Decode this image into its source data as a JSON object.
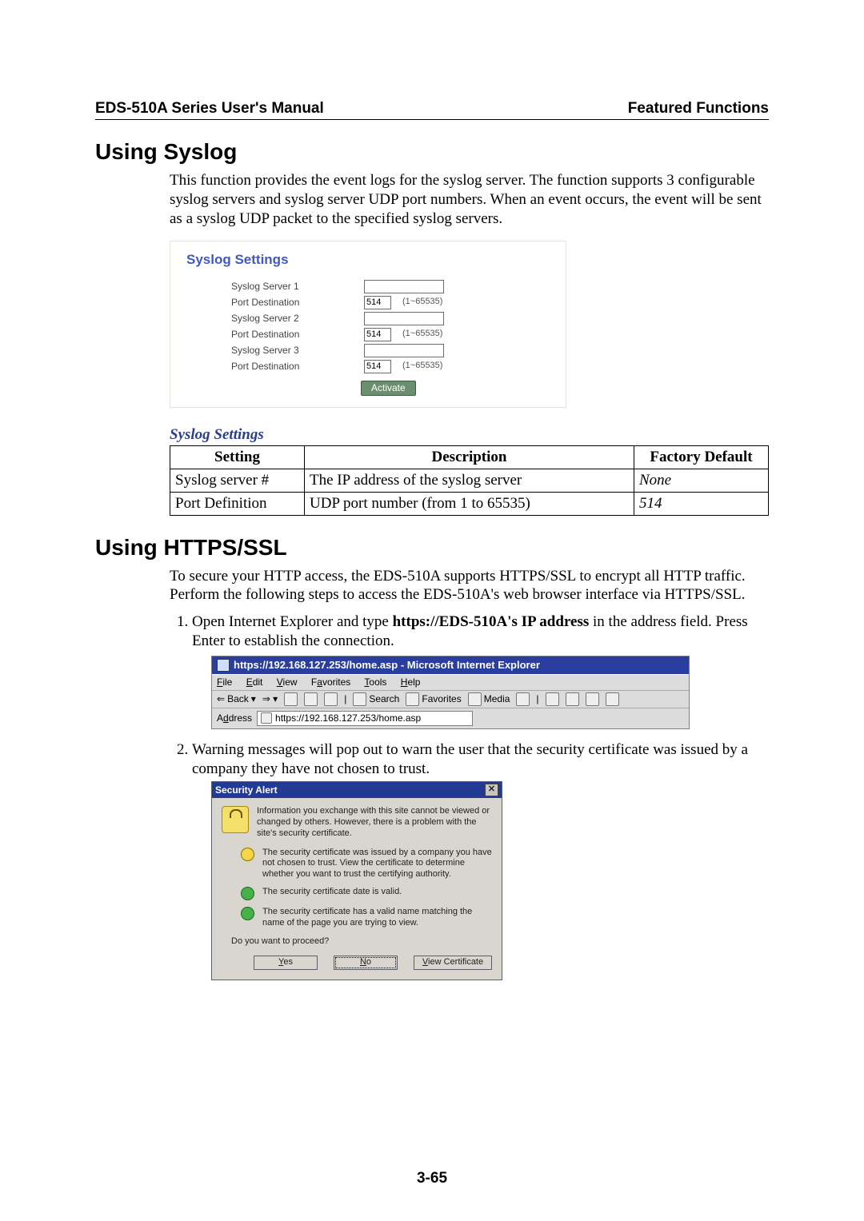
{
  "header": {
    "left": "EDS-510A Series User's Manual",
    "right": "Featured Functions"
  },
  "sec1": {
    "title": "Using Syslog",
    "intro": "This function provides the event logs for the syslog server. The function supports 3 configurable syslog servers and syslog server UDP port numbers. When an event occurs, the event will be sent as a syslog UDP packet to the specified syslog servers."
  },
  "syslog_ui": {
    "title": "Syslog Settings",
    "rows": [
      {
        "label": "Syslog Server 1",
        "value": "",
        "hint": ""
      },
      {
        "label": "Port Destination",
        "value": "514",
        "hint": "(1~65535)"
      },
      {
        "label": "Syslog Server 2",
        "value": "",
        "hint": ""
      },
      {
        "label": "Port Destination",
        "value": "514",
        "hint": "(1~65535)"
      },
      {
        "label": "Syslog Server 3",
        "value": "",
        "hint": ""
      },
      {
        "label": "Port Destination",
        "value": "514",
        "hint": "(1~65535)"
      }
    ],
    "button": "Activate"
  },
  "settings_table": {
    "caption": "Syslog Settings",
    "head": {
      "c1": "Setting",
      "c2": "Description",
      "c3": "Factory Default"
    },
    "rows": [
      {
        "c1": "Syslog server #",
        "c2": "The IP address of the syslog server",
        "c3": "None"
      },
      {
        "c1": "Port Definition",
        "c2": "UDP port number (from 1 to 65535)",
        "c3": "514"
      }
    ]
  },
  "sec2": {
    "title": "Using HTTPS/SSL",
    "intro": "To secure your HTTP access, the EDS-510A supports HTTPS/SSL to encrypt all HTTP traffic. Perform the following steps to access the EDS-510A's web browser interface via HTTPS/SSL.",
    "step1_a": "Open Internet Explorer and type ",
    "step1_b": "https://EDS-510A's IP address",
    "step1_c": " in the address field. Press Enter to establish the connection.",
    "step2": "Warning messages will pop out to warn the user that the security certificate was issued by a company they have not chosen to trust."
  },
  "ie": {
    "title": "https://192.168.127.253/home.asp - Microsoft Internet Explorer",
    "menu": {
      "file": "File",
      "edit": "Edit",
      "view": "View",
      "fav": "Favorites",
      "tools": "Tools",
      "help": "Help"
    },
    "toolbar": {
      "back": "Back",
      "search": "Search",
      "favorites": "Favorites",
      "media": "Media"
    },
    "addr_label": "Address",
    "addr_value": "https://192.168.127.253/home.asp"
  },
  "sa": {
    "title": "Security Alert",
    "p1": "Information you exchange with this site cannot be viewed or changed by others. However, there is a problem with the site's security certificate.",
    "b1": "The security certificate was issued by a company you have not chosen to trust. View the certificate to determine whether you want to trust the certifying authority.",
    "b2": "The security certificate date is valid.",
    "b3": "The security certificate has a valid name matching the name of the page you are trying to view.",
    "q": "Do you want to proceed?",
    "yes": "Yes",
    "no": "No",
    "view": "View Certificate"
  },
  "page_number": "3-65"
}
